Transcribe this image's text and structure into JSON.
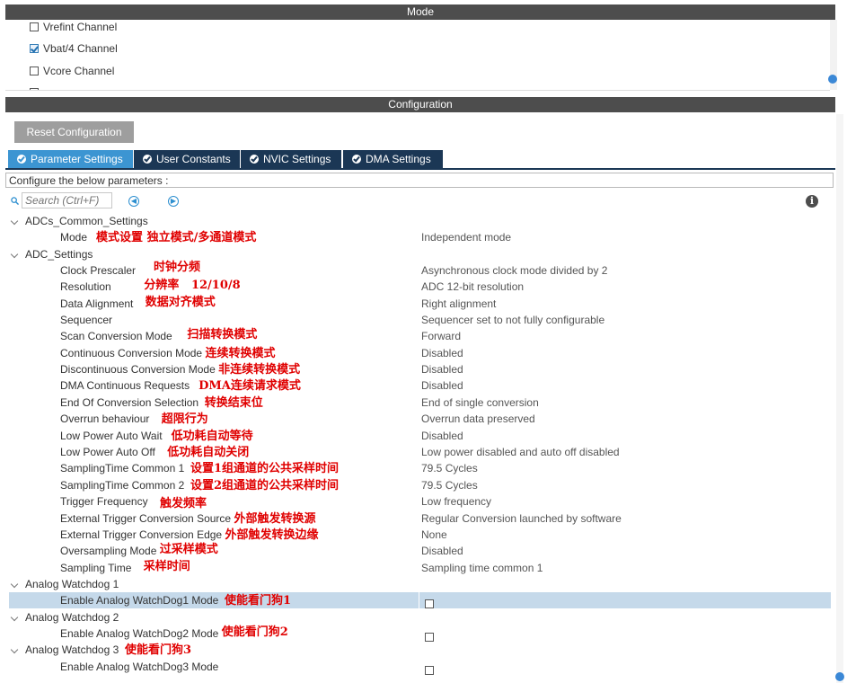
{
  "mode": {
    "title": "Mode",
    "channels": [
      {
        "label": "Vrefint Channel",
        "checked": false
      },
      {
        "label": "Vbat/4 Channel",
        "checked": true
      },
      {
        "label": "Vcore Channel",
        "checked": false
      },
      {
        "label": "",
        "checked": false
      }
    ]
  },
  "configuration": {
    "title": "Configuration",
    "reset_label": "Reset Configuration",
    "tabs": [
      {
        "label": "Parameter Settings",
        "active": true
      },
      {
        "label": "User Constants",
        "active": false
      },
      {
        "label": "NVIC Settings",
        "active": false
      },
      {
        "label": "DMA Settings",
        "active": false
      }
    ],
    "instructions": "Configure the below parameters :",
    "search_placeholder": "Search (Ctrl+F)",
    "info_symbol": "i"
  },
  "groups": [
    {
      "name": "ADCs_Common_Settings",
      "params": [
        {
          "name": "Mode",
          "value": "Independent mode",
          "note": "模式设置  独立模式/多通道模式"
        }
      ]
    },
    {
      "name": "ADC_Settings",
      "params": [
        {
          "name": "Clock Prescaler",
          "value": "Asynchronous clock mode divided by 2",
          "note": "时钟分频"
        },
        {
          "name": "Resolution",
          "value": "ADC 12-bit resolution",
          "note": "分辨率   12/10/8"
        },
        {
          "name": "Data Alignment",
          "value": "Right alignment",
          "note": "数据对齐模式"
        },
        {
          "name": "Sequencer",
          "value": "Sequencer set to not fully configurable",
          "note": ""
        },
        {
          "name": "Scan Conversion Mode",
          "value": "Forward",
          "note": "扫描转换模式"
        },
        {
          "name": "Continuous Conversion Mode",
          "value": "Disabled",
          "note": "连续转换模式"
        },
        {
          "name": "Discontinuous Conversion Mode",
          "value": "Disabled",
          "note": "非连续转换模式"
        },
        {
          "name": "DMA Continuous Requests",
          "value": "Disabled",
          "note": "DMA连续请求模式"
        },
        {
          "name": "End Of Conversion Selection",
          "value": "End of single conversion",
          "note": "转换结束位"
        },
        {
          "name": "Overrun behaviour",
          "value": "Overrun data preserved",
          "note": "超限行为"
        },
        {
          "name": "Low Power Auto Wait",
          "value": "Disabled",
          "note": "低功耗自动等待"
        },
        {
          "name": "Low Power Auto Off",
          "value": "Low power disabled and auto off disabled",
          "note": "低功耗自动关闭"
        },
        {
          "name": "SamplingTime Common 1",
          "value": "79.5 Cycles",
          "note": "设置1组通道的公共采样时间"
        },
        {
          "name": "SamplingTime Common 2",
          "value": "79.5 Cycles",
          "note": "设置2组通道的公共采样时间"
        },
        {
          "name": "Trigger Frequency",
          "value": "Low frequency",
          "note": "触发频率"
        },
        {
          "name": "External Trigger Conversion Source",
          "value": "Regular Conversion launched by software",
          "note": "外部触发转换源"
        },
        {
          "name": "External Trigger Conversion Edge",
          "value": "None",
          "note": "外部触发转换边缘"
        },
        {
          "name": "Oversampling Mode",
          "value": "Disabled",
          "note": "过采样模式"
        },
        {
          "name": "Sampling Time",
          "value": "Sampling time common 1",
          "note": "采样时间"
        }
      ]
    },
    {
      "name": "Analog Watchdog 1",
      "note": "",
      "params": [
        {
          "name": "Enable Analog WatchDog1 Mode",
          "checkbox": true,
          "checked": false,
          "note": "使能看门狗1",
          "selected": true
        }
      ]
    },
    {
      "name": "Analog Watchdog 2",
      "note": "",
      "params": [
        {
          "name": "Enable Analog WatchDog2 Mode",
          "checkbox": true,
          "checked": false,
          "note": "使能看门狗2"
        }
      ]
    },
    {
      "name": "Analog Watchdog 3",
      "note": "使能看门狗3",
      "params": [
        {
          "name": "Enable Analog WatchDog3 Mode",
          "checkbox": true,
          "checked": false,
          "note": ""
        }
      ]
    }
  ],
  "colors": {
    "header_bar": "#4d4d4d",
    "tab_active": "#3c95d2",
    "tab_inactive": "#1b3755",
    "annotation": "#e00000",
    "selected_row": "#c5d9ea"
  }
}
